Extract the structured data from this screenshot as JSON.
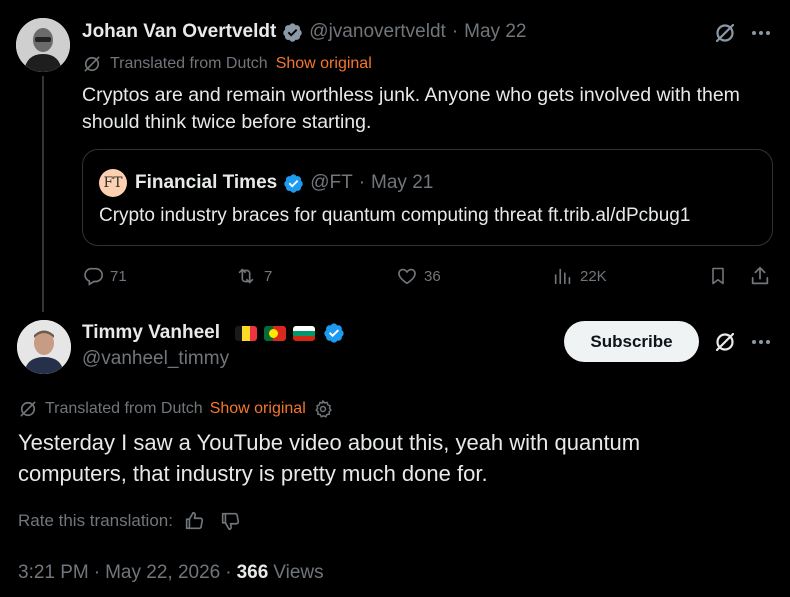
{
  "parent": {
    "name": "Johan Van Overtveldt",
    "handle": "@jvanovertveldt",
    "separator": "·",
    "date": "May 22",
    "translated_label": "Translated from Dutch",
    "show_original": "Show original",
    "text": "Cryptos are and remain worthless junk. Anyone who gets involved with them should think twice before starting.",
    "quote": {
      "logo_text": "FT",
      "name": "Financial Times",
      "handle": "@FT",
      "separator": "·",
      "date": "May 21",
      "text": "Crypto industry braces for quantum computing threat ft.trib.al/dPcbug1"
    },
    "actions": {
      "replies": "71",
      "reposts": "7",
      "likes": "36",
      "views": "22K"
    }
  },
  "reply": {
    "name": "Timmy Vanheel",
    "handle": "@vanheel_timmy",
    "subscribe_label": "Subscribe",
    "translated_label": "Translated from Dutch",
    "show_original": "Show original",
    "text": "Yesterday I saw a YouTube video about this, yeah with quantum computers, that industry is pretty much done for.",
    "rate_label": "Rate this translation:",
    "time": "3:21 PM",
    "separator": "·",
    "date": "May 22, 2026",
    "views_count": "366",
    "views_label": "Views"
  },
  "colors": {
    "verified": "#1d9bf0",
    "accent_link": "#f4772b",
    "muted": "#71767b"
  },
  "icons": [
    "grok-icon",
    "more-icon",
    "reply-icon",
    "repost-icon",
    "like-icon",
    "views-icon",
    "bookmark-icon",
    "share-icon",
    "translate-icon",
    "settings-icon",
    "thumbs-up-icon",
    "thumbs-down-icon",
    "verified-badge"
  ]
}
